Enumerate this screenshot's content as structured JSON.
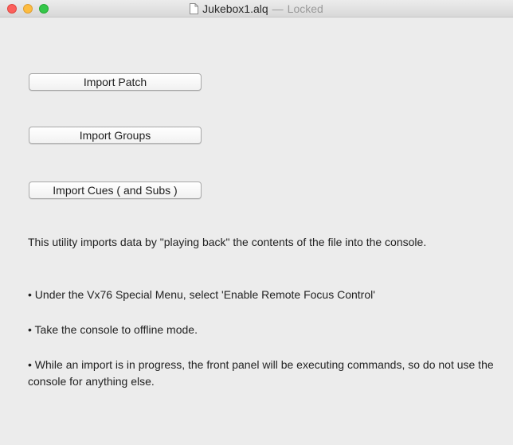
{
  "window": {
    "filename": "Jukebox1.alq",
    "separator": "—",
    "status": "Locked"
  },
  "buttons": {
    "import_patch": "Import Patch",
    "import_groups": "Import Groups",
    "import_cues": "Import Cues ( and Subs )"
  },
  "info": {
    "intro": "This utility imports data by \"playing back\" the contents of the file into the console.",
    "bullet1": "• Under the Vx76 Special Menu, select 'Enable Remote Focus Control'",
    "bullet2": "• Take the console to offline mode.",
    "bullet3": "• While an import is in progress, the front panel will be executing commands, so do not use the console for anything else."
  },
  "colors": {
    "close": "#fc605c",
    "minimize": "#fdbc40",
    "zoom": "#34c749",
    "background": "#ececec"
  },
  "icons": {
    "title": "document-icon"
  }
}
